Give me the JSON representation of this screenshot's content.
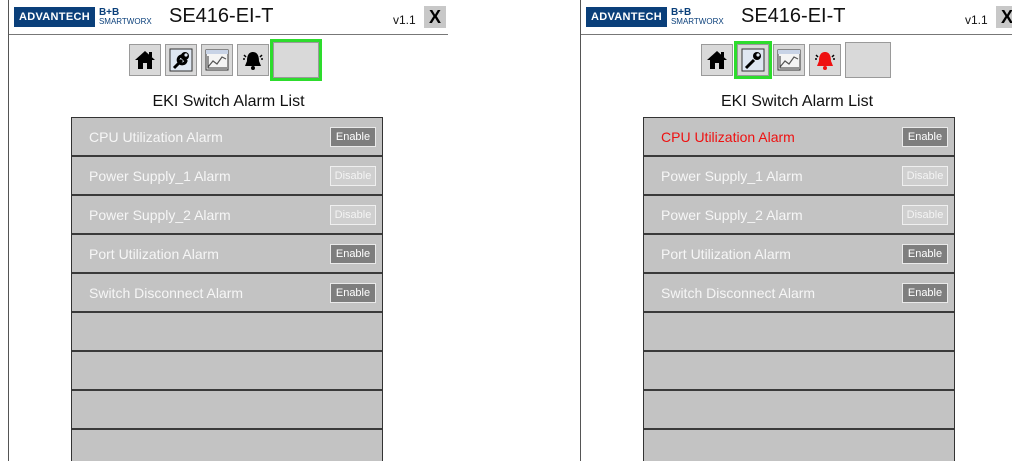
{
  "colors": {
    "selected_outline": "#2ddc2d",
    "alarm_active_text": "#ee1111",
    "list_bg": "#c3c3c3",
    "logo_blue": "#0a3f7a"
  },
  "panels": [
    {
      "logo": {
        "brand": "ADVANTECH",
        "sub_top": "B+B",
        "sub_bottom": "SMARTWORX"
      },
      "device_title": "SE416-EI-T",
      "version": "v1.1",
      "close_label": "X",
      "toolbar": [
        {
          "icon": "home-icon",
          "selected": false
        },
        {
          "icon": "wrench-icon",
          "selected": false
        },
        {
          "icon": "chart-icon",
          "selected": false
        },
        {
          "icon": "alarm-bell-icon",
          "selected": false,
          "alarm_active": false
        },
        {
          "icon": "blank",
          "selected": true
        }
      ],
      "list_heading": "EKI Switch Alarm List",
      "alarms": [
        {
          "name": "CPU Utilization Alarm",
          "button": "Enable",
          "active": false
        },
        {
          "name": "Power Supply_1 Alarm",
          "button": "Disable",
          "active": false
        },
        {
          "name": "Power Supply_2 Alarm",
          "button": "Disable",
          "active": false
        },
        {
          "name": "Port Utilization Alarm",
          "button": "Enable",
          "active": false
        },
        {
          "name": "Switch Disconnect  Alarm",
          "button": "Enable",
          "active": false
        },
        {
          "name": "",
          "button": ""
        },
        {
          "name": "",
          "button": ""
        },
        {
          "name": "",
          "button": ""
        },
        {
          "name": "",
          "button": ""
        }
      ]
    },
    {
      "logo": {
        "brand": "ADVANTECH",
        "sub_top": "B+B",
        "sub_bottom": "SMARTWORX"
      },
      "device_title": "SE416-EI-T",
      "version": "v1.1",
      "close_label": "X",
      "toolbar": [
        {
          "icon": "home-icon",
          "selected": false
        },
        {
          "icon": "wrench-icon",
          "selected": true
        },
        {
          "icon": "chart-icon",
          "selected": false
        },
        {
          "icon": "alarm-bell-icon",
          "selected": false,
          "alarm_active": true
        },
        {
          "icon": "blank",
          "selected": false
        }
      ],
      "list_heading": "EKI Switch Alarm List",
      "alarms": [
        {
          "name": "CPU Utilization Alarm",
          "button": "Enable",
          "active": true
        },
        {
          "name": "Power Supply_1 Alarm",
          "button": "Disable",
          "active": false
        },
        {
          "name": "Power Supply_2 Alarm",
          "button": "Disable",
          "active": false
        },
        {
          "name": "Port Utilization Alarm",
          "button": "Enable",
          "active": false
        },
        {
          "name": "Switch Disconnect  Alarm",
          "button": "Enable",
          "active": false
        },
        {
          "name": "",
          "button": ""
        },
        {
          "name": "",
          "button": ""
        },
        {
          "name": "",
          "button": ""
        },
        {
          "name": "",
          "button": ""
        }
      ]
    }
  ]
}
